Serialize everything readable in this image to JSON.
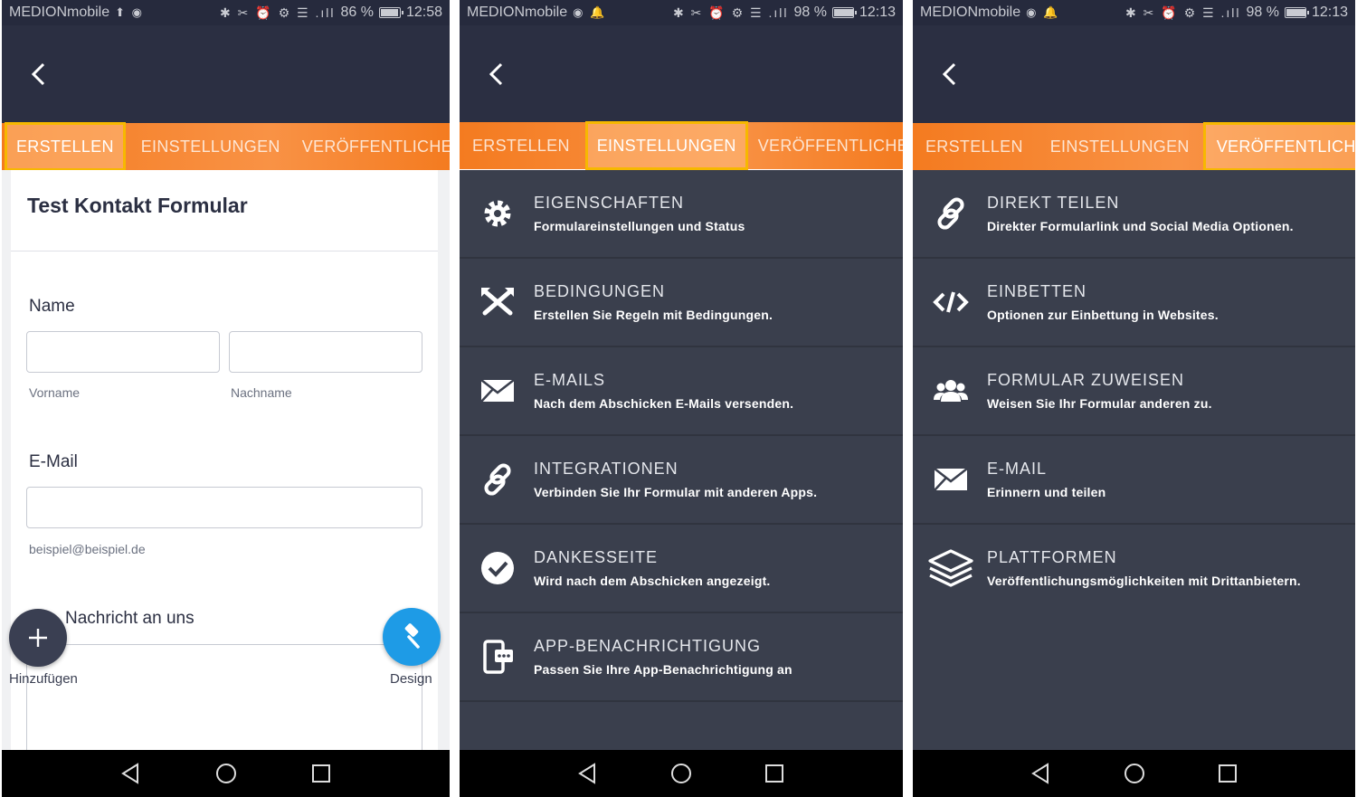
{
  "screens": [
    {
      "status": {
        "carrier": "MEDIONmobile",
        "extra_icons": "⬆ ◉",
        "sys_icons": "✱ ✂ ⏰ ⚙ ☰ .ıll",
        "battery_text": "86 %",
        "battery_level": 0.86,
        "time": "12:58"
      },
      "tabs": [
        "ERSTELLEN",
        "EINSTELLUNGEN",
        "VERÖFFENTLICHEN"
      ],
      "active_tab": 0,
      "form": {
        "title": "Test Kontakt Formular",
        "name_label": "Name",
        "first_hint": "Vorname",
        "last_hint": "Nachname",
        "email_label": "E-Mail",
        "email_hint": "beispiel@beispiel.de",
        "message_label": "Nachricht an uns"
      },
      "fab_add_label": "Hinzufügen",
      "fab_design_label": "Design"
    },
    {
      "status": {
        "carrier": "MEDIONmobile",
        "extra_icons": "◉ 🔔",
        "sys_icons": "✱ ✂ ⏰ ⚙ ☰ .ıll",
        "battery_text": "98 %",
        "battery_level": 0.98,
        "time": "12:13"
      },
      "tabs": [
        "ERSTELLEN",
        "EINSTELLUNGEN",
        "VERÖFFENTLICHEN"
      ],
      "active_tab": 1,
      "items": [
        {
          "icon": "gear-icon",
          "title": "EIGENSCHAFTEN",
          "subtitle": "Formulareinstellungen und Status"
        },
        {
          "icon": "conditions-icon",
          "title": "BEDINGUNGEN",
          "subtitle": "Erstellen Sie Regeln mit Bedingungen."
        },
        {
          "icon": "envelope-icon",
          "title": "E-MAILS",
          "subtitle": "Nach dem Abschicken E-Mails versenden."
        },
        {
          "icon": "link-icon",
          "title": "INTEGRATIONEN",
          "subtitle": "Verbinden Sie Ihr Formular mit anderen Apps."
        },
        {
          "icon": "check-circle-icon",
          "title": "DANKESSEITE",
          "subtitle": "Wird nach dem Abschicken angezeigt."
        },
        {
          "icon": "app-notification-icon",
          "title": "APP-BENACHRICHTIGUNG",
          "subtitle": "Passen Sie Ihre App-Benachrichtigung an"
        }
      ]
    },
    {
      "status": {
        "carrier": "MEDIONmobile",
        "extra_icons": "◉ 🔔",
        "sys_icons": "✱ ✂ ⏰ ⚙ ☰ .ıll",
        "battery_text": "98 %",
        "battery_level": 0.98,
        "time": "12:13"
      },
      "tabs": [
        "ERSTELLEN",
        "EINSTELLUNGEN",
        "VERÖFFENTLICHEN"
      ],
      "active_tab": 2,
      "items": [
        {
          "icon": "link-icon",
          "title": "DIREKT TEILEN",
          "subtitle": "Direkter Formularlink und Social Media Optionen."
        },
        {
          "icon": "code-icon",
          "title": "EINBETTEN",
          "subtitle": "Optionen zur Einbettung in Websites."
        },
        {
          "icon": "users-icon",
          "title": "FORMULAR ZUWEISEN",
          "subtitle": "Weisen Sie Ihr Formular anderen zu."
        },
        {
          "icon": "envelope-icon",
          "title": "E-MAIL",
          "subtitle": "Erinnern und teilen"
        },
        {
          "icon": "layers-icon",
          "title": "PLATTFORMEN",
          "subtitle": "Veröffentlichungsmöglichkeiten mit Drittanbietern."
        }
      ]
    }
  ],
  "colors": {
    "tab_orange": "#f58220",
    "highlight": "#f7b800",
    "dark": "#2b2f42",
    "menu_bg": "#3a3f4d",
    "fab_blue": "#1e9be6"
  }
}
